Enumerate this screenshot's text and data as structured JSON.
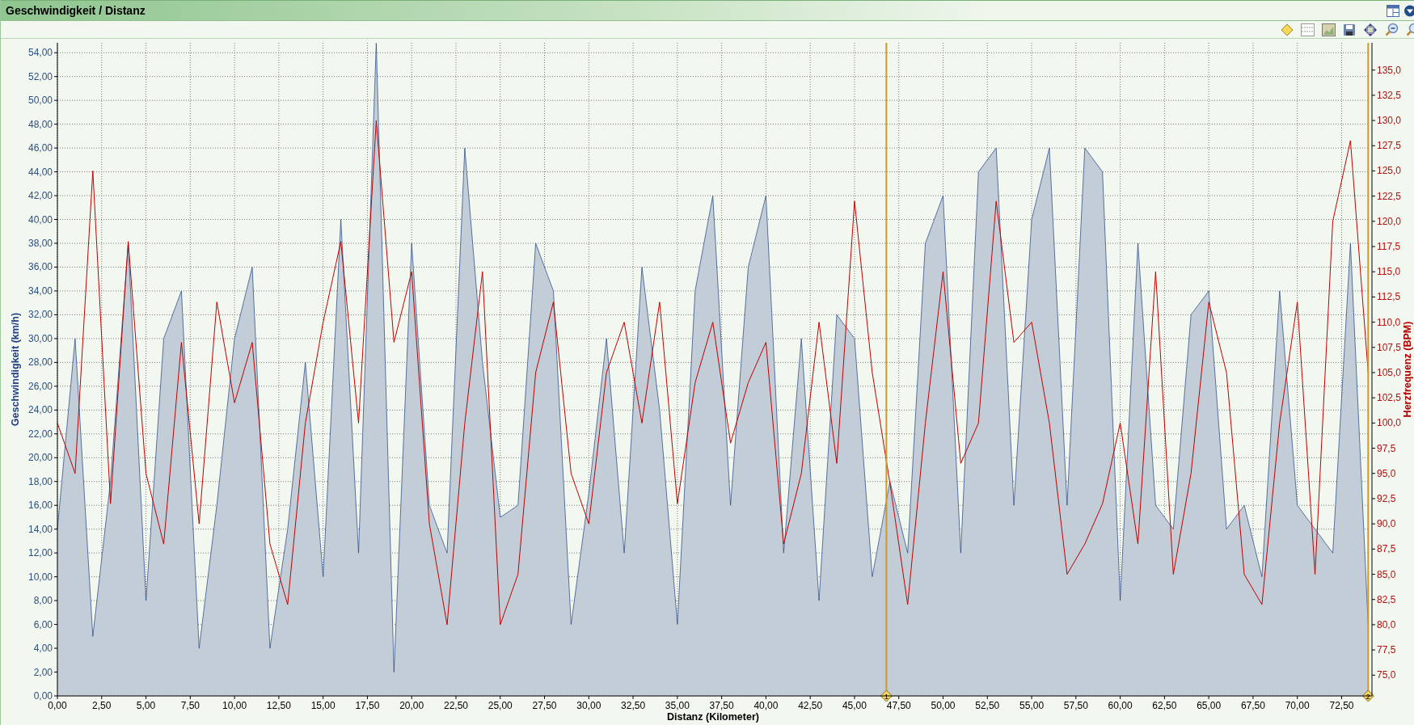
{
  "window": {
    "title": "Geschwindigkeit / Distanz"
  },
  "chart": {
    "chart_data": {
      "type": "line",
      "grid": true,
      "xlabel": "Distanz (Kilometer)",
      "ylabel": "Geschwindigkeit (km/h)",
      "y2label": "Herzfrequenz (BPM)",
      "x": [
        0,
        1,
        2,
        3,
        4,
        5,
        6,
        7,
        8,
        9,
        10,
        11,
        12,
        13,
        14,
        15,
        16,
        17,
        18,
        19,
        20,
        21,
        22,
        23,
        24,
        25,
        26,
        27,
        28,
        29,
        30,
        31,
        32,
        33,
        34,
        35,
        36,
        37,
        38,
        39,
        40,
        41,
        42,
        43,
        44,
        45,
        46,
        47,
        48,
        49,
        50,
        51,
        52,
        53,
        54,
        55,
        56,
        57,
        58,
        59,
        60,
        61,
        62,
        63,
        64,
        65,
        66,
        67,
        68,
        69,
        70,
        71,
        72,
        73,
        74
      ],
      "xlim": [
        0,
        74.03
      ],
      "ylim": [
        0,
        54.83
      ],
      "y2lim": [
        72.94,
        137.7
      ],
      "series": [
        {
          "type": "area",
          "color": "#1f3f7f",
          "values": [
            14,
            30,
            5,
            18,
            38,
            8,
            30,
            34,
            4,
            16,
            30,
            36,
            4,
            14,
            28,
            10,
            40,
            12,
            54.8,
            2,
            38,
            16,
            12,
            46,
            28,
            15,
            16,
            38,
            34,
            6,
            17,
            30,
            12,
            36,
            24,
            6,
            34,
            42,
            16,
            36,
            42,
            12,
            30,
            8,
            32,
            30,
            10,
            18,
            12,
            38,
            42,
            12,
            44,
            46,
            16,
            40,
            46,
            16,
            46,
            44,
            8,
            38,
            16,
            14,
            32,
            34,
            14,
            16,
            10,
            34,
            16,
            14,
            12,
            38,
            6
          ]
        },
        {
          "axis": "y2",
          "color": "#c00000",
          "values": [
            100,
            95,
            125,
            92,
            118,
            95,
            88,
            108,
            90,
            112,
            102,
            108,
            88,
            82,
            100,
            110,
            118,
            100,
            130,
            108,
            115,
            90,
            80,
            100,
            115,
            80,
            85,
            105,
            112,
            95,
            90,
            105,
            110,
            100,
            112,
            92,
            104,
            110,
            98,
            104,
            108,
            88,
            95,
            110,
            96,
            122,
            105,
            94,
            82,
            100,
            115,
            96,
            100,
            122,
            108,
            110,
            100,
            85,
            88,
            92,
            100,
            88,
            115,
            85,
            95,
            112,
            105,
            85,
            82,
            100,
            112,
            85,
            120,
            128,
            105
          ]
        }
      ],
      "xticks": [
        {
          "value": 0,
          "label": "0,00"
        },
        {
          "value": 2.5,
          "label": "2,50"
        },
        {
          "value": 5,
          "label": "5,00"
        },
        {
          "value": 7.5,
          "label": "7,50"
        },
        {
          "value": 10,
          "label": "10,00"
        },
        {
          "value": 12.5,
          "label": "12,50"
        },
        {
          "value": 15,
          "label": "15,00"
        },
        {
          "value": 17.5,
          "label": "17,50"
        },
        {
          "value": 20,
          "label": "20,00"
        },
        {
          "value": 22.5,
          "label": "22,50"
        },
        {
          "value": 25,
          "label": "25,00"
        },
        {
          "value": 27.5,
          "label": "27,50"
        },
        {
          "value": 30,
          "label": "30,00"
        },
        {
          "value": 32.5,
          "label": "32,50"
        },
        {
          "value": 35,
          "label": "35,00"
        },
        {
          "value": 37.5,
          "label": "37,50"
        },
        {
          "value": 40,
          "label": "40,00"
        },
        {
          "value": 42.5,
          "label": "42,50"
        },
        {
          "value": 45,
          "label": "45,00"
        },
        {
          "value": 47.5,
          "label": "47,50"
        },
        {
          "value": 50,
          "label": "50,00"
        },
        {
          "value": 52.5,
          "label": "52,50"
        },
        {
          "value": 55,
          "label": "55,00"
        },
        {
          "value": 57.5,
          "label": "57,50"
        },
        {
          "value": 60,
          "label": "60,00"
        },
        {
          "value": 62.5,
          "label": "62,50"
        },
        {
          "value": 65,
          "label": "65,00"
        },
        {
          "value": 67.5,
          "label": "67,50"
        },
        {
          "value": 70,
          "label": "70,00"
        },
        {
          "value": 72.5,
          "label": "72,50"
        }
      ],
      "yticks": [
        {
          "value": 0,
          "label": "0,00"
        },
        {
          "value": 2,
          "label": "2,00"
        },
        {
          "value": 4,
          "label": "4,00"
        },
        {
          "value": 6,
          "label": "6,00"
        },
        {
          "value": 8,
          "label": "8,00"
        },
        {
          "value": 10,
          "label": "10,00"
        },
        {
          "value": 12,
          "label": "12,00"
        },
        {
          "value": 14,
          "label": "14,00"
        },
        {
          "value": 16,
          "label": "16,00"
        },
        {
          "value": 18,
          "label": "18,00"
        },
        {
          "value": 20,
          "label": "20,00"
        },
        {
          "value": 22,
          "label": "22,00"
        },
        {
          "value": 24,
          "label": "24,00"
        },
        {
          "value": 26,
          "label": "26,00"
        },
        {
          "value": 28,
          "label": "28,00"
        },
        {
          "value": 30,
          "label": "30,00"
        },
        {
          "value": 32,
          "label": "32,00"
        },
        {
          "value": 34,
          "label": "34,00"
        },
        {
          "value": 36,
          "label": "36,00"
        },
        {
          "value": 38,
          "label": "38,00"
        },
        {
          "value": 40,
          "label": "40,00"
        },
        {
          "value": 42,
          "label": "42,00"
        },
        {
          "value": 44,
          "label": "44,00"
        },
        {
          "value": 46,
          "label": "46,00"
        },
        {
          "value": 48,
          "label": "48,00"
        },
        {
          "value": 50,
          "label": "50,00"
        },
        {
          "value": 52,
          "label": "52,00"
        },
        {
          "value": 54,
          "label": "54,00"
        }
      ],
      "y2ticks": [
        {
          "value": 75,
          "label": "75,0"
        },
        {
          "value": 77.5,
          "label": "77,5"
        },
        {
          "value": 80,
          "label": "80,0"
        },
        {
          "value": 82.5,
          "label": "82,5"
        },
        {
          "value": 85,
          "label": "85,0"
        },
        {
          "value": 87.5,
          "label": "87,5"
        },
        {
          "value": 90,
          "label": "90,0"
        },
        {
          "value": 92.5,
          "label": "92,5"
        },
        {
          "value": 95,
          "label": "95,0"
        },
        {
          "value": 97.5,
          "label": "97,5"
        },
        {
          "value": 100,
          "label": "100,0"
        },
        {
          "value": 102.5,
          "label": "102,5"
        },
        {
          "value": 105,
          "label": "105,0"
        },
        {
          "value": 107.5,
          "label": "107,5"
        },
        {
          "value": 110,
          "label": "110,0"
        },
        {
          "value": 112.5,
          "label": "112,5"
        },
        {
          "value": 115,
          "label": "115,0"
        },
        {
          "value": 117.5,
          "label": "117,5"
        },
        {
          "value": 120,
          "label": "120,0"
        },
        {
          "value": 122.5,
          "label": "122,5"
        },
        {
          "value": 125,
          "label": "125,0"
        },
        {
          "value": 127.5,
          "label": "127,5"
        },
        {
          "value": 130,
          "label": "130,0"
        },
        {
          "value": 132.5,
          "label": "132,5"
        },
        {
          "value": 135,
          "label": "135,0"
        }
      ],
      "annotations": [
        {
          "x": 46.8,
          "text": "1"
        },
        {
          "x": 74,
          "text": "2"
        }
      ]
    }
  }
}
